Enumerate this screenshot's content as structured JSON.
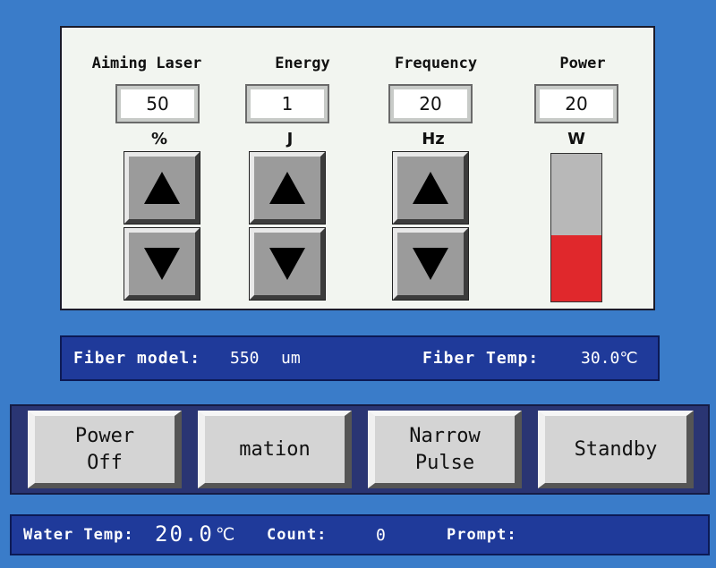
{
  "controls": {
    "aiming": {
      "title": "Aiming Laser",
      "value": "50",
      "unit": "%"
    },
    "energy": {
      "title": "Energy",
      "value": "1",
      "unit": "J"
    },
    "frequency": {
      "title": "Frequency",
      "value": "20",
      "unit": "Hz"
    },
    "power": {
      "title": "Power",
      "value": "20",
      "unit": "W",
      "bar_fill_fraction": 0.45,
      "bar_fill_color": "#e0282c"
    }
  },
  "fiber": {
    "model_label": "Fiber model:",
    "model_value": "550",
    "model_unit": "um",
    "temp_label": "Fiber Temp:",
    "temp_value": "30.0℃"
  },
  "buttons": {
    "power_off": "Power\nOff",
    "mation": "mation",
    "narrow_pulse": "Narrow\nPulse",
    "standby": "Standby"
  },
  "status": {
    "water_label": "Water Temp:",
    "water_value": "20.0",
    "water_unit": "℃",
    "count_label": "Count:",
    "count_value": "0",
    "prompt_label": "Prompt:"
  },
  "icons": {
    "up": "triangle-up-icon",
    "down": "triangle-down-icon"
  },
  "colors": {
    "background": "#3a7cc9",
    "dark_panel": "#1f3a9a",
    "button_panel": "#2a3573"
  }
}
